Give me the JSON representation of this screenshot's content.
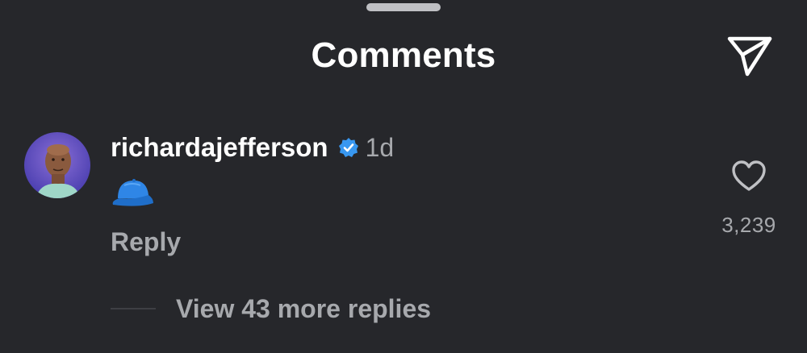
{
  "header": {
    "title": "Comments",
    "share_icon": "paper-plane-icon"
  },
  "comment": {
    "avatar_icon": "user-avatar",
    "username": "richardajefferson",
    "verified_icon": "verified-badge-icon",
    "timestamp": "1d",
    "body_emoji": "blue-cap-emoji",
    "reply_label": "Reply",
    "like_icon": "heart-outline-icon",
    "like_count": "3,239",
    "view_replies_label": "View 43 more replies"
  },
  "colors": {
    "background": "#26272b",
    "primary_text": "#ffffff",
    "secondary_text": "#a7a9ad",
    "verified_blue": "#3897f0",
    "cap_blue": "#2f86e6"
  }
}
